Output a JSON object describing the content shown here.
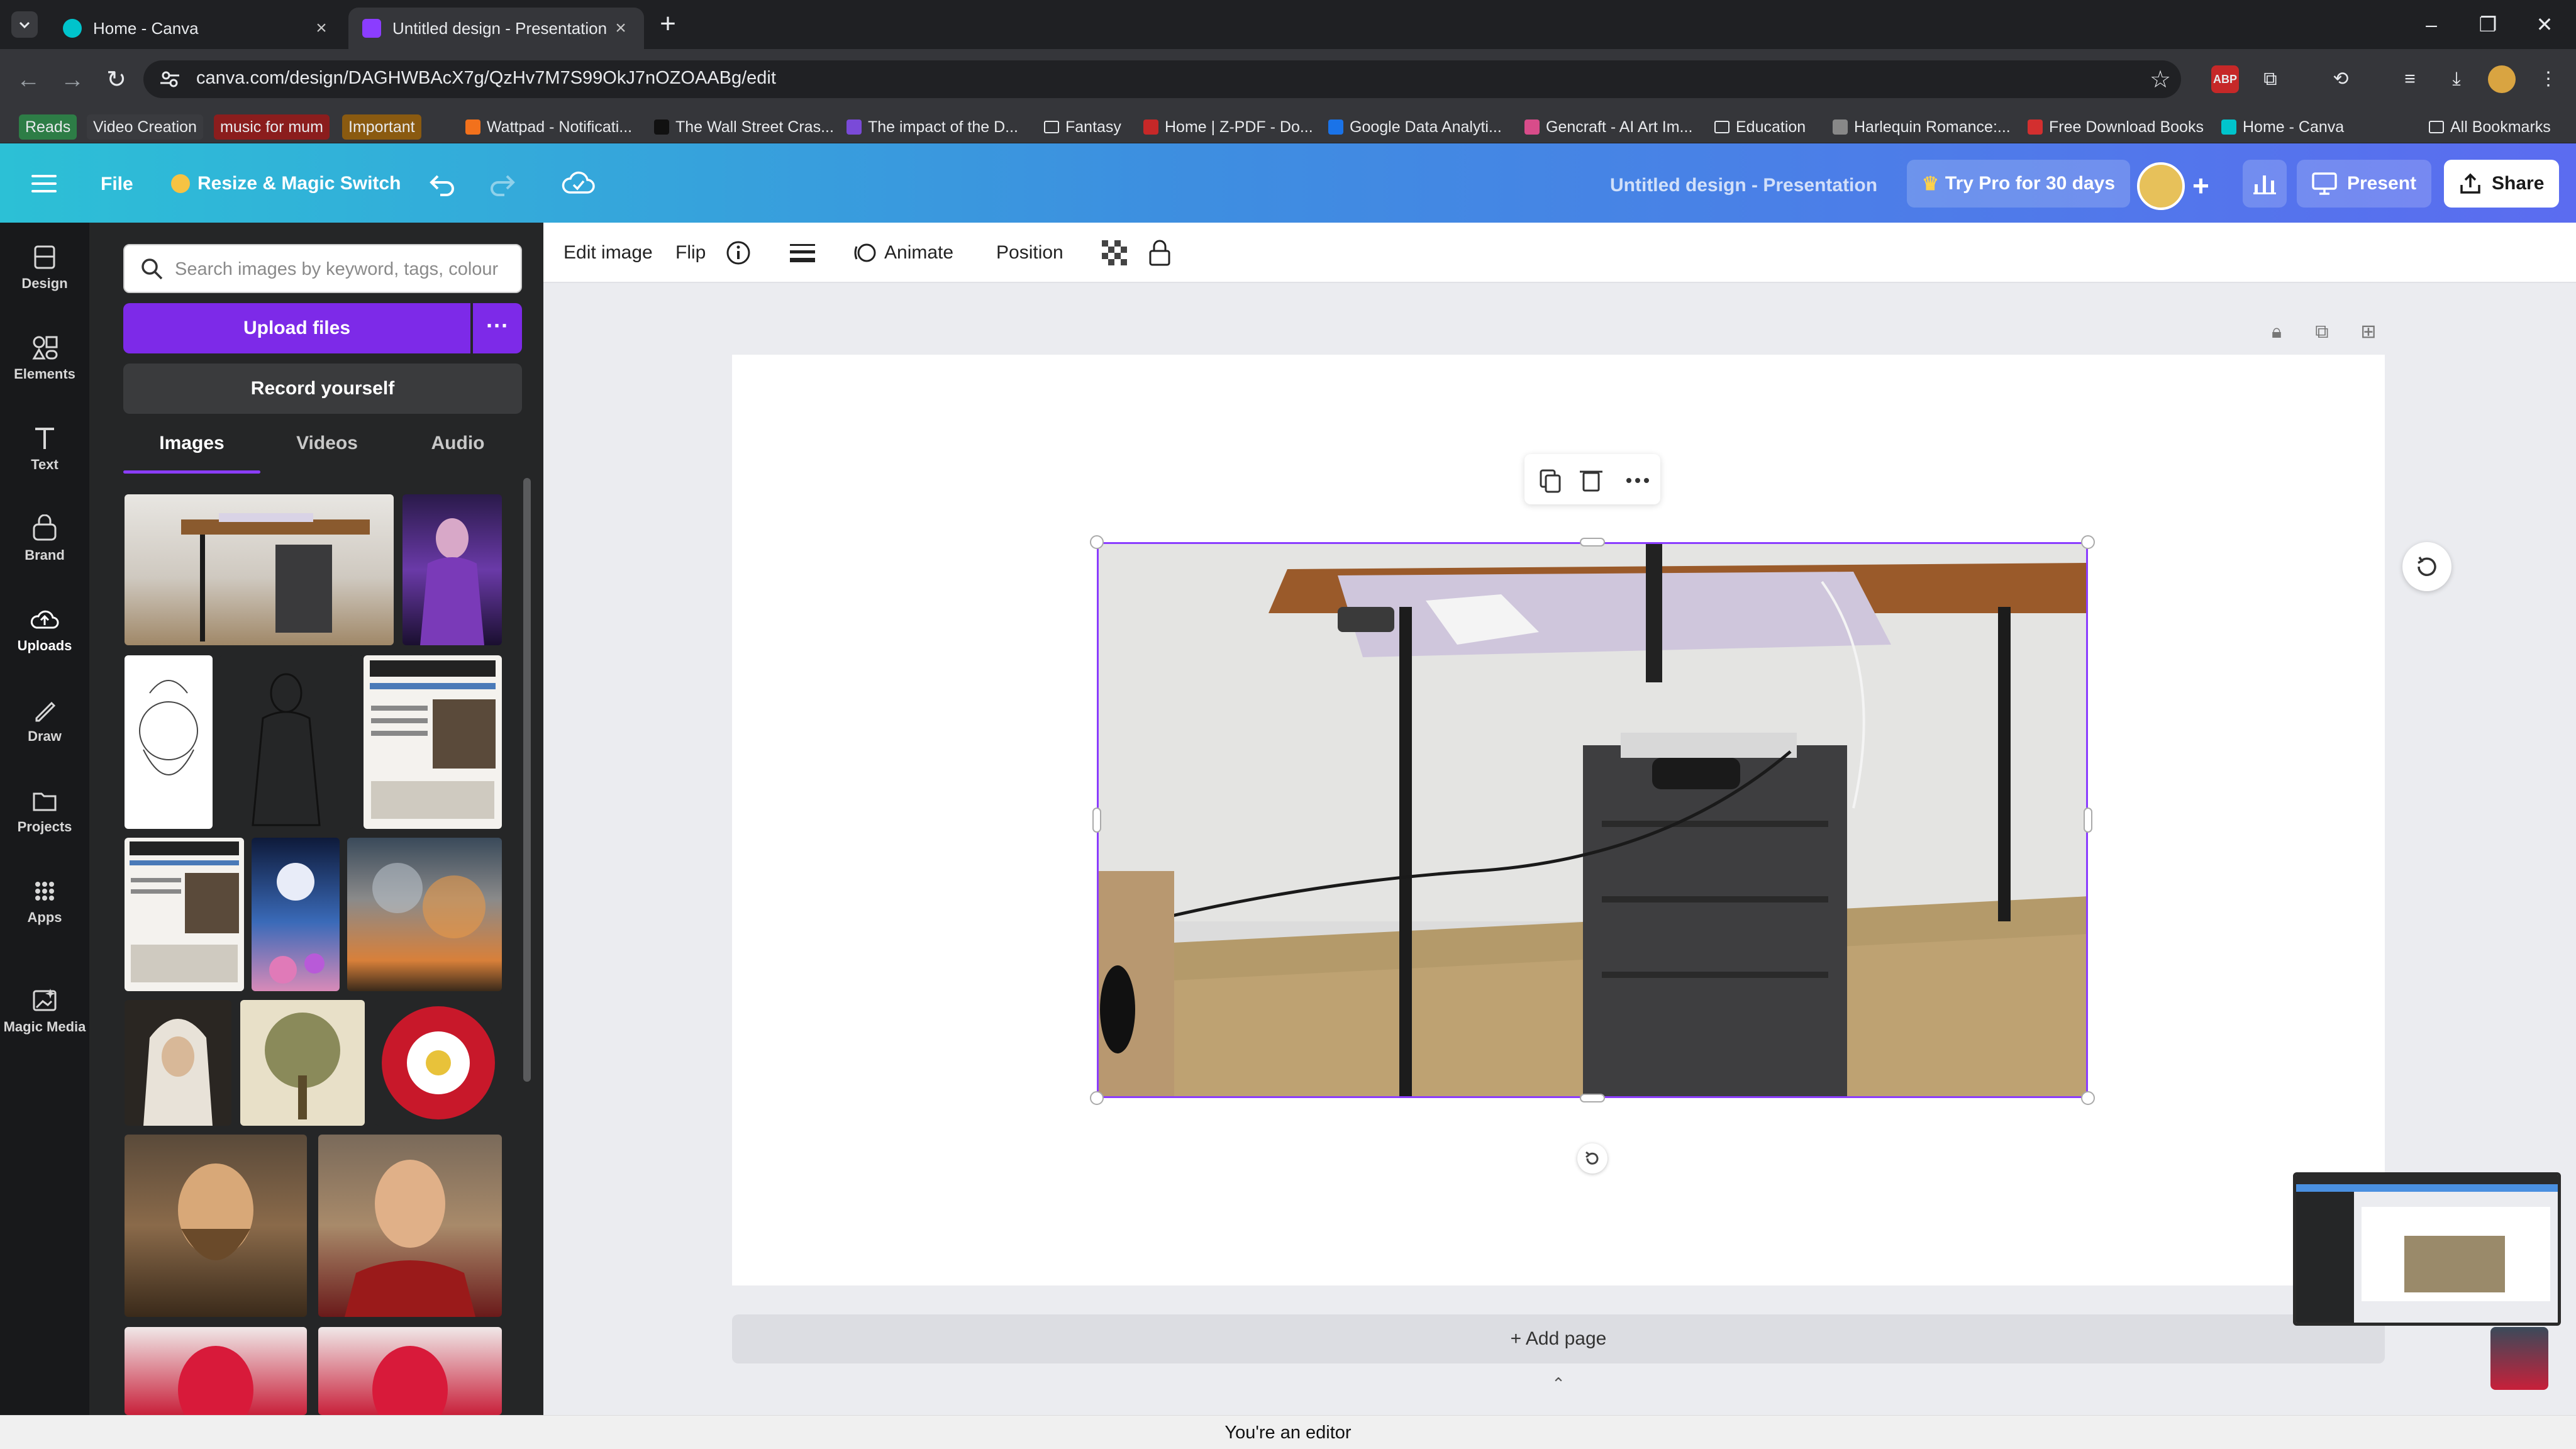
{
  "browser": {
    "tabs": [
      {
        "title": "Home - Canva",
        "active": false
      },
      {
        "title": "Untitled design - Presentation",
        "active": true
      }
    ],
    "url": "canva.com/design/DAGHWBAcX7g/QzHv7M7S99OkJ7nOZOAABg/edit",
    "bookmarks": [
      {
        "label": "Reads",
        "style": "chip",
        "color": "#2d7d46"
      },
      {
        "label": "Video Creation",
        "style": "chip",
        "color": "#3a3b3f"
      },
      {
        "label": "music for mum",
        "style": "chip",
        "color": "#8b1d1d"
      },
      {
        "label": "Important",
        "style": "chip",
        "color": "#8a5a10"
      },
      {
        "label": "Wattpad - Notificati...",
        "style": "icon",
        "color": "#f2711c"
      },
      {
        "label": "The Wall Street Cras...",
        "style": "icon",
        "color": "#111111"
      },
      {
        "label": "The impact of the D...",
        "style": "icon",
        "color": "#7a4ad8"
      },
      {
        "label": "Fantasy",
        "style": "folder",
        "color": "#e8eaed"
      },
      {
        "label": "Home | Z-PDF - Do...",
        "style": "icon",
        "color": "#c62828"
      },
      {
        "label": "Google Data Analyti...",
        "style": "icon",
        "color": "#1a73e8"
      },
      {
        "label": "Gencraft - AI Art Im...",
        "style": "icon",
        "color": "#d84c8a"
      },
      {
        "label": "Education",
        "style": "folder",
        "color": "#e8eaed"
      },
      {
        "label": "Harlequin Romance:...",
        "style": "icon",
        "color": "#888888"
      },
      {
        "label": "Free Download Books",
        "style": "icon",
        "color": "#d32f2f"
      },
      {
        "label": "Home - Canva",
        "style": "icon",
        "color": "#00c4cc"
      },
      {
        "label": "All Bookmarks",
        "style": "folder",
        "color": "#e8eaed"
      }
    ]
  },
  "header": {
    "file": "File",
    "resize": "Resize & Magic Switch",
    "title": "Untitled design - Presentation",
    "pro": "Try Pro for 30 days",
    "present": "Present",
    "share": "Share"
  },
  "rail": [
    {
      "label": "Design",
      "icon": "design-icon"
    },
    {
      "label": "Elements",
      "icon": "elements-icon"
    },
    {
      "label": "Text",
      "icon": "text-icon"
    },
    {
      "label": "Brand",
      "icon": "brand-icon"
    },
    {
      "label": "Uploads",
      "icon": "uploads-icon"
    },
    {
      "label": "Draw",
      "icon": "draw-icon"
    },
    {
      "label": "Projects",
      "icon": "projects-icon"
    },
    {
      "label": "Apps",
      "icon": "apps-icon"
    },
    {
      "label": "Magic Media",
      "icon": "magic-media-icon"
    }
  ],
  "panel": {
    "search_placeholder": "Search images by keyword, tags, colour",
    "upload": "Upload files",
    "record": "Record yourself",
    "tabs": [
      "Images",
      "Videos",
      "Audio"
    ]
  },
  "toolbar": {
    "edit_image": "Edit image",
    "flip": "Flip",
    "animate": "Animate",
    "position": "Position"
  },
  "canvas": {
    "add_page": "+ Add page"
  },
  "footer": {
    "status": "You're an editor"
  },
  "colors": {
    "accent": "#8b3dff",
    "upload_button": "#7d2ae8"
  }
}
